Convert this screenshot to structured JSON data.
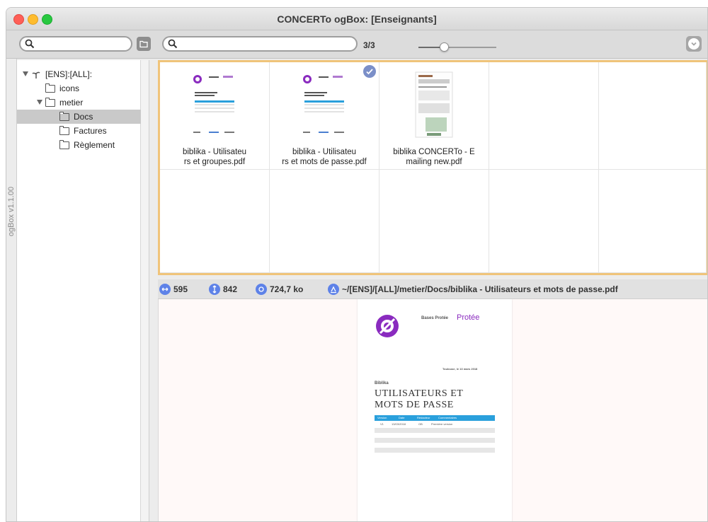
{
  "window": {
    "title": "CONCERTo ogBox: [Enseignants]",
    "version_label": "ogBox v1.1.00"
  },
  "toolbar": {
    "left_search": {
      "value": "",
      "placeholder": ""
    },
    "main_search": {
      "value": "",
      "placeholder": ""
    },
    "result_count": "3/3",
    "zoom_fraction": 0.33
  },
  "tree": {
    "items": [
      {
        "label": "[ENS]:[ALL]:",
        "icon": "plant-icon",
        "level": 0,
        "expanded": true,
        "selected": false
      },
      {
        "label": "icons",
        "icon": "folder-icon",
        "level": 1,
        "expanded": false,
        "selected": false
      },
      {
        "label": "metier",
        "icon": "folder-icon",
        "level": 1,
        "expanded": true,
        "selected": false
      },
      {
        "label": "Docs",
        "icon": "folder-icon",
        "level": 2,
        "expanded": false,
        "selected": true
      },
      {
        "label": "Factures",
        "icon": "folder-icon",
        "level": 2,
        "expanded": false,
        "selected": false
      },
      {
        "label": "Règlement",
        "icon": "folder-icon",
        "level": 2,
        "expanded": false,
        "selected": false
      }
    ]
  },
  "grid": {
    "files": [
      {
        "name_line1": "biblika - Utilisateu",
        "name_line2": "rs et groupes.pdf",
        "checked": false,
        "thumb": "doc-purple"
      },
      {
        "name_line1": "biblika - Utilisateu",
        "name_line2": "rs et mots de passe.pdf",
        "checked": true,
        "thumb": "doc-purple"
      },
      {
        "name_line1": "biblika CONCERTo - E",
        "name_line2": "mailing new.pdf",
        "checked": false,
        "thumb": "doc-screens"
      }
    ]
  },
  "info": {
    "width": "595",
    "height": "842",
    "size": "724,7 ko",
    "path": "~/[ENS]/[ALL]/metier/Docs/biblika - Utilisateurs et mots de passe.pdf"
  },
  "preview": {
    "header_left": "Bases Protée",
    "brand": "Protée",
    "date_line": "Toulouse, le 13 mars 2018",
    "section": "Biblika",
    "title_line1": "UTILISATEURS ET",
    "title_line2": "MOTS DE PASSE",
    "table_headers": [
      "Version",
      "Date",
      "Rédacteur",
      "Commentaires"
    ],
    "table_row": [
      "V1",
      "13/03/2018",
      "OB",
      "Première version"
    ]
  },
  "colors": {
    "accent_blue": "#5e82e8",
    "grid_border": "#f0c47a",
    "brand_purple": "#8a2bbf",
    "table_header": "#2aa0dc"
  }
}
